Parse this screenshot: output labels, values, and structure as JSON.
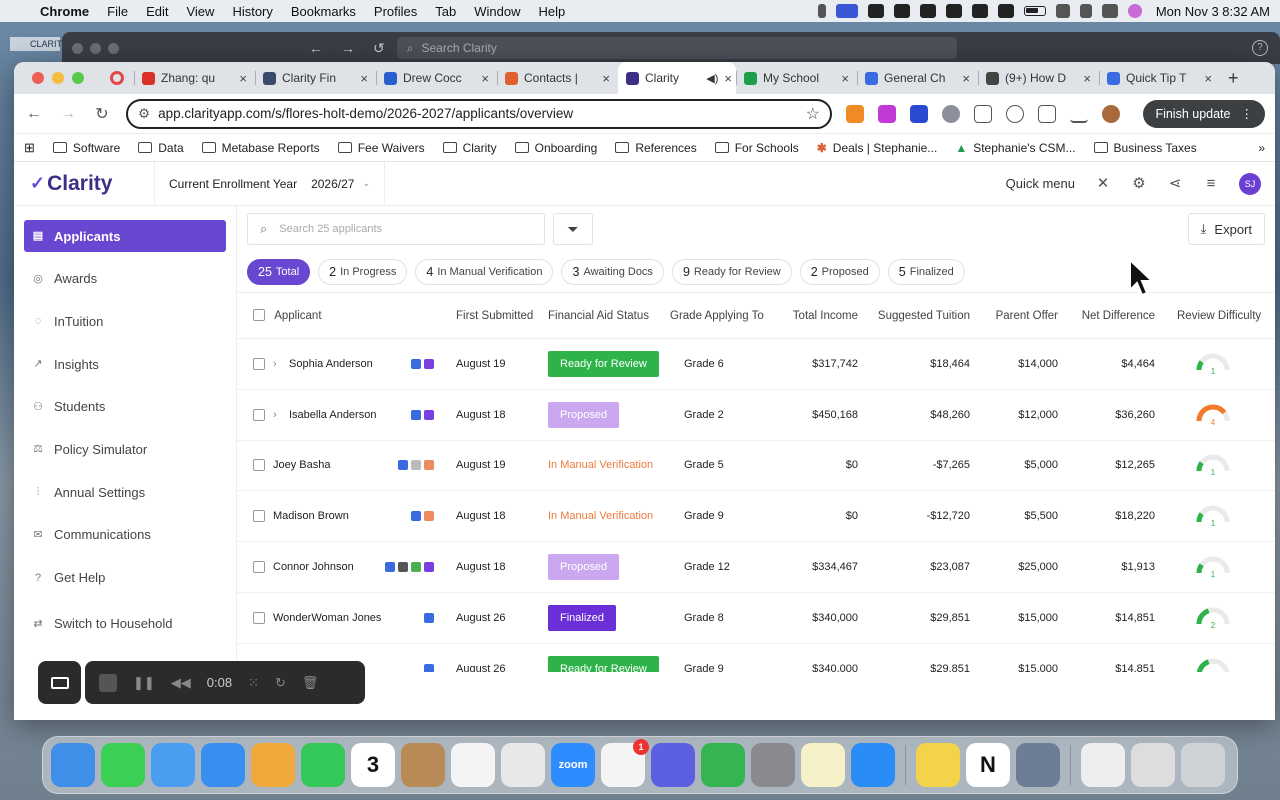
{
  "menubar": {
    "app": "Chrome",
    "items": [
      "File",
      "Edit",
      "View",
      "History",
      "Bookmarks",
      "Profiles",
      "Tab",
      "Window",
      "Help"
    ],
    "clock": "Mon Nov 3  8:32 AM"
  },
  "backwindow": {
    "search_placeholder": "Search Clarity",
    "side_tag": "CLARIT"
  },
  "tabs": [
    {
      "label": "Zhang: qu",
      "color": "#d93025"
    },
    {
      "label": "Clarity Fin",
      "color": "#3b4a6b"
    },
    {
      "label": "Drew Cocc",
      "color": "#2a5fd0"
    },
    {
      "label": "Contacts |",
      "color": "#e06030"
    },
    {
      "label": "Clarity",
      "color": "#3b2f86",
      "active": true
    },
    {
      "label": "My School",
      "color": "#1e9e4a"
    },
    {
      "label": "General Ch",
      "color": "#3a6be0"
    },
    {
      "label": "(9+) How D",
      "color": "#444444"
    },
    {
      "label": "Quick Tip T",
      "color": "#3a6be0"
    }
  ],
  "toolbar": {
    "url": "app.clarityapp.com/s/flores-holt-demo/2026-2027/applicants/overview",
    "finish_update": "Finish update"
  },
  "bookmarks": [
    "Software",
    "Data",
    "Metabase Reports",
    "Fee Waivers",
    "Clarity",
    "Onboarding",
    "References",
    "For Schools",
    "Deals | Stephanie...",
    "Stephanie's CSM...",
    "Business Taxes"
  ],
  "app": {
    "logo": "Clarity",
    "year_label": "Current Enrollment Year",
    "year_value": "2026/27",
    "quick_menu": "Quick menu",
    "avatar": "SJ"
  },
  "sidebar": {
    "items": [
      {
        "label": "Applicants",
        "icon": "document-icon"
      },
      {
        "label": "Awards",
        "icon": "check-circle-icon"
      },
      {
        "label": "InTuition",
        "icon": "bulb-icon"
      },
      {
        "label": "Insights",
        "icon": "trend-icon"
      },
      {
        "label": "Students",
        "icon": "users-icon"
      },
      {
        "label": "Policy Simulator",
        "icon": "scale-icon"
      },
      {
        "label": "Annual Settings",
        "icon": "sliders-icon"
      },
      {
        "label": "Communications",
        "icon": "mail-icon"
      },
      {
        "label": "Get Help",
        "icon": "help-icon"
      },
      {
        "label": "Switch to Household",
        "icon": "swap-icon"
      }
    ]
  },
  "controls": {
    "search_placeholder": "Search 25 applicants",
    "export": "Export"
  },
  "pills": [
    {
      "count": "25",
      "label": "Total",
      "active": true
    },
    {
      "count": "2",
      "label": "In Progress"
    },
    {
      "count": "4",
      "label": "In Manual Verification"
    },
    {
      "count": "3",
      "label": "Awaiting Docs"
    },
    {
      "count": "9",
      "label": "Ready for Review"
    },
    {
      "count": "2",
      "label": "Proposed"
    },
    {
      "count": "5",
      "label": "Finalized"
    }
  ],
  "table": {
    "headers": [
      "Applicant",
      "First Submitted",
      "Financial Aid Status",
      "Grade Applying To",
      "Total Income",
      "Suggested Tuition",
      "Parent Offer",
      "Net Difference",
      "Review Difficulty"
    ],
    "rows": [
      {
        "name": "Sophia Anderson",
        "expand": true,
        "badges": [
          "#3a6be0",
          "#7a3fe0"
        ],
        "date": "August 19",
        "status": "Ready for Review",
        "status_kind": "ready",
        "grade": "Grade 6",
        "income": "$317,742",
        "tuition": "$18,464",
        "offer": "$14,000",
        "diff": "$4,464",
        "difficulty": 1
      },
      {
        "name": "Isabella Anderson",
        "expand": true,
        "badges": [
          "#3a6be0",
          "#7a3fe0"
        ],
        "date": "August 18",
        "status": "Proposed",
        "status_kind": "proposed",
        "grade": "Grade 2",
        "income": "$450,168",
        "tuition": "$48,260",
        "offer": "$12,000",
        "diff": "$36,260",
        "difficulty": 4
      },
      {
        "name": "Joey Basha",
        "expand": false,
        "badges": [
          "#3a6be0",
          "#bbbbbb",
          "#ee8a5d"
        ],
        "date": "August 19",
        "status": "In Manual Verification",
        "status_kind": "manual",
        "grade": "Grade 5",
        "income": "$0",
        "tuition": "-$7,265",
        "offer": "$5,000",
        "diff": "$12,265",
        "difficulty": 1
      },
      {
        "name": "Madison Brown",
        "expand": false,
        "badges": [
          "#3a6be0",
          "#ee8a5d"
        ],
        "date": "August 18",
        "status": "In Manual Verification",
        "status_kind": "manual",
        "grade": "Grade 9",
        "income": "$0",
        "tuition": "-$12,720",
        "offer": "$5,500",
        "diff": "$18,220",
        "difficulty": 1
      },
      {
        "name": "Connor Johnson",
        "expand": false,
        "badges": [
          "#3a6be0",
          "#555555",
          "#4caf50",
          "#7a3fe0"
        ],
        "date": "August 18",
        "status": "Proposed",
        "status_kind": "proposed",
        "grade": "Grade 12",
        "income": "$334,467",
        "tuition": "$23,087",
        "offer": "$25,000",
        "diff": "$1,913",
        "difficulty": 1
      },
      {
        "name": "WonderWoman Jones",
        "expand": false,
        "badges": [
          "#3a6be0"
        ],
        "date": "August 26",
        "status": "Finalized",
        "status_kind": "final",
        "grade": "Grade 8",
        "income": "$340,000",
        "tuition": "$29,851",
        "offer": "$15,000",
        "diff": "$14,851",
        "difficulty": 2
      },
      {
        "name": "",
        "expand": false,
        "badges": [
          "#3a6be0"
        ],
        "date": "August 26",
        "status": "Ready for Review",
        "status_kind": "ready",
        "grade": "Grade 9",
        "income": "$340,000",
        "tuition": "$29,851",
        "offer": "$15,000",
        "diff": "$14,851",
        "difficulty": 2
      }
    ]
  },
  "recorder": {
    "time": "0:08"
  },
  "dock": {
    "apps": [
      {
        "name": "finder",
        "color": "#3f8fe8"
      },
      {
        "name": "messages",
        "color": "#3ccf56"
      },
      {
        "name": "mail",
        "color": "#4a9ef2"
      },
      {
        "name": "safari",
        "color": "#3a8ef0"
      },
      {
        "name": "photos",
        "color": "#f2a93b"
      },
      {
        "name": "facetime",
        "color": "#34c759"
      },
      {
        "name": "calendar",
        "color": "#ffffff",
        "text": "3"
      },
      {
        "name": "contacts",
        "color": "#b88a55"
      },
      {
        "name": "reminders",
        "color": "#f4f4f4"
      },
      {
        "name": "chrome",
        "color": "#e8e8e8"
      },
      {
        "name": "zoom",
        "color": "#2d8cff",
        "text": "zoom"
      },
      {
        "name": "slack",
        "color": "#f4f4f4",
        "badge": "1"
      },
      {
        "name": "settings-app",
        "color": "#5b5fe0"
      },
      {
        "name": "numbers",
        "color": "#34b552"
      },
      {
        "name": "system-preferences",
        "color": "#8a8a8e"
      },
      {
        "name": "notes",
        "color": "#f7f1c9"
      },
      {
        "name": "app-store",
        "color": "#2a8cf7"
      },
      {
        "name": "stickies",
        "color": "#f3d34a"
      },
      {
        "name": "notion",
        "color": "#ffffff",
        "text": "N"
      },
      {
        "name": "preview",
        "color": "#6d7d95"
      },
      {
        "name": "csv-file",
        "color": "#eeeeee"
      },
      {
        "name": "downloads",
        "color": "#dddddd"
      },
      {
        "name": "trash",
        "color": "#cfd3d8"
      }
    ]
  }
}
